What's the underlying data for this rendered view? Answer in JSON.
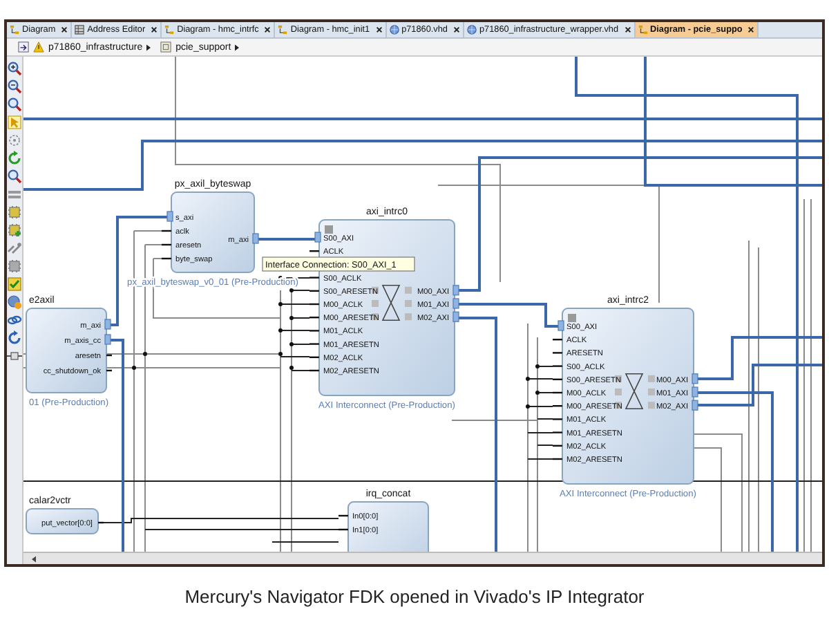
{
  "tabs": [
    {
      "label": "Diagram",
      "kind": "diagram",
      "selected": false
    },
    {
      "label": "Address Editor",
      "kind": "address",
      "selected": false
    },
    {
      "label": "Diagram - hmc_intrfc",
      "kind": "diagram",
      "selected": false
    },
    {
      "label": "Diagram - hmc_init1",
      "kind": "diagram",
      "selected": false
    },
    {
      "label": "p71860.vhd",
      "kind": "vhd",
      "selected": false
    },
    {
      "label": "p71860_infrastructure_wrapper.vhd",
      "kind": "vhd",
      "selected": false
    },
    {
      "label": "Diagram - pcie_suppo",
      "kind": "diagram",
      "selected": true
    }
  ],
  "breadcrumb": [
    {
      "label": "p71860_infrastructure",
      "kind": "warning"
    },
    {
      "label": "pcie_support",
      "kind": "block"
    }
  ],
  "blocks": [
    {
      "title": "px_axil_byteswap",
      "kind": "ip",
      "subtitle": "px_axil_byteswap_v0_01 (Pre-Production)",
      "inputs": [
        {
          "label": "s_axi",
          "kind": "interface"
        },
        {
          "label": "aclk",
          "kind": "signal"
        },
        {
          "label": "aresetn",
          "kind": "signal"
        },
        {
          "label": "byte_swap",
          "kind": "signal"
        }
      ],
      "outputs": [
        {
          "label": "m_axi",
          "kind": "interface"
        }
      ]
    },
    {
      "title": "e2axil",
      "kind": "ip",
      "subtitle": "01 (Pre-Production)",
      "outputs": [
        {
          "label": "m_axi",
          "kind": "interface"
        },
        {
          "label": "m_axis_cc",
          "kind": "interface"
        },
        {
          "label": "aresetn",
          "kind": "signal"
        },
        {
          "label": "cc_shutdown_ok",
          "kind": "signal"
        }
      ]
    },
    {
      "title": "axi_intrc0",
      "kind": "interconnect",
      "subtitle": "AXI Interconnect (Pre-Production)",
      "inputs": [
        {
          "label": "S00_AXI",
          "kind": "interface"
        },
        {
          "label": "ACLK",
          "kind": "signal"
        },
        {
          "label": "S00_ACLK",
          "kind": "signal"
        },
        {
          "label": "S00_ARESETN",
          "kind": "signal"
        },
        {
          "label": "M00_ACLK",
          "kind": "signal"
        },
        {
          "label": "M00_ARESETN",
          "kind": "signal"
        },
        {
          "label": "M01_ACLK",
          "kind": "signal"
        },
        {
          "label": "M01_ARESETN",
          "kind": "signal"
        },
        {
          "label": "M02_ACLK",
          "kind": "signal"
        },
        {
          "label": "M02_ARESETN",
          "kind": "signal"
        }
      ],
      "outputs": [
        {
          "label": "M00_AXI",
          "kind": "interface"
        },
        {
          "label": "M01_AXI",
          "kind": "interface"
        },
        {
          "label": "M02_AXI",
          "kind": "interface"
        }
      ]
    },
    {
      "title": "axi_intrc2",
      "kind": "interconnect",
      "subtitle": "AXI Interconnect (Pre-Production)",
      "inputs": [
        {
          "label": "S00_AXI",
          "kind": "interface"
        },
        {
          "label": "ACLK",
          "kind": "signal"
        },
        {
          "label": "ARESETN",
          "kind": "signal"
        },
        {
          "label": "S00_ACLK",
          "kind": "signal"
        },
        {
          "label": "S00_ARESETN",
          "kind": "signal"
        },
        {
          "label": "M00_ACLK",
          "kind": "signal"
        },
        {
          "label": "M00_ARESETN",
          "kind": "signal"
        },
        {
          "label": "M01_ACLK",
          "kind": "signal"
        },
        {
          "label": "M01_ARESETN",
          "kind": "signal"
        },
        {
          "label": "M02_ACLK",
          "kind": "signal"
        },
        {
          "label": "M02_ARESETN",
          "kind": "signal"
        }
      ],
      "outputs": [
        {
          "label": "M00_AXI",
          "kind": "interface"
        },
        {
          "label": "M01_AXI",
          "kind": "interface"
        },
        {
          "label": "M02_AXI",
          "kind": "interface"
        }
      ]
    },
    {
      "title": "calar2vctr",
      "kind": "ip",
      "outputs": [
        {
          "label": "put_vector[0:0]",
          "kind": "signal"
        }
      ]
    },
    {
      "title": "irq_concat",
      "kind": "ip",
      "inputs": [
        {
          "label": "In0[0:0]",
          "kind": "signal"
        },
        {
          "label": "In1[0:0]",
          "kind": "signal"
        }
      ]
    }
  ],
  "tooltip": "Interface Connection: S00_AXI_1",
  "caption": "Mercury's Navigator FDK opened in Vivado's IP Integrator"
}
